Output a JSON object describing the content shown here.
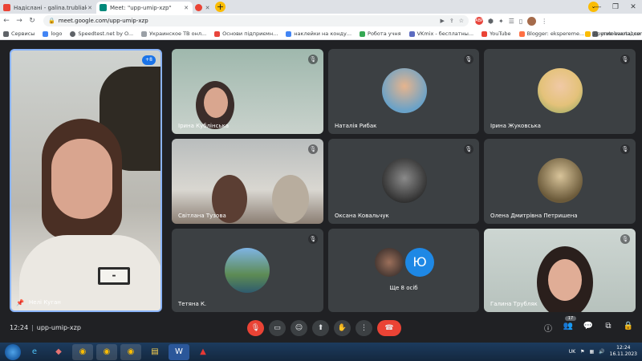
{
  "browser": {
    "tabs": [
      {
        "title": "Надіслані - galina.trubliak@gmail",
        "favicon_color": "#ea4335"
      },
      {
        "title": "Meet: \"upp-umip-xzp\"",
        "favicon_color": "#00897b"
      }
    ],
    "url": "meet.google.com/upp-umip-xzp"
  },
  "bookmarks": [
    {
      "label": "Сервисы",
      "color": "#5f6368"
    },
    {
      "label": "logo",
      "color": "#4285f4"
    },
    {
      "label": "Speedtest.net by O...",
      "color": "#5f6368"
    },
    {
      "label": "Украинское ТВ онл...",
      "color": "#5f6368"
    },
    {
      "label": "Основи підприємн...",
      "color": "#e8453c"
    },
    {
      "label": "наклейки на конду...",
      "color": "#4285f4"
    },
    {
      "label": "Робота учня",
      "color": "#34a853"
    },
    {
      "label": "VKmix - бесплатны...",
      "color": "#5c6bc0"
    },
    {
      "label": "YouTube",
      "color": "#ea4335"
    },
    {
      "label": "Blogger: eksperemе...",
      "color": "#ff7043"
    },
    {
      "label": "motokvartal.com.ua...",
      "color": "#5f6368"
    },
    {
      "label": "Другие закладки",
      "color": "#fbbc04"
    }
  ],
  "participants": {
    "main": {
      "name": "Нелі Куган",
      "others_count": "+8"
    },
    "tiles": [
      {
        "name": "Ірина Кублінська"
      },
      {
        "name": "Наталія Рибак"
      },
      {
        "name": "Ірина Жуковська"
      },
      {
        "name": "Світлана Тузова"
      },
      {
        "name": "Оксана Ковальчук"
      },
      {
        "name": "Олена Дмитрівна Петришена"
      },
      {
        "name": "Тетяна К."
      },
      {
        "name": "Ще 8 осіб",
        "initial": "Ю"
      },
      {
        "name": "Галина Трубляк"
      }
    ]
  },
  "meeting": {
    "time": "12:24",
    "code": "upp-umip-xzp",
    "participant_count": "17"
  },
  "taskbar": {
    "lang": "UK",
    "clock_time": "12:24",
    "clock_date": "16.11.2023"
  }
}
